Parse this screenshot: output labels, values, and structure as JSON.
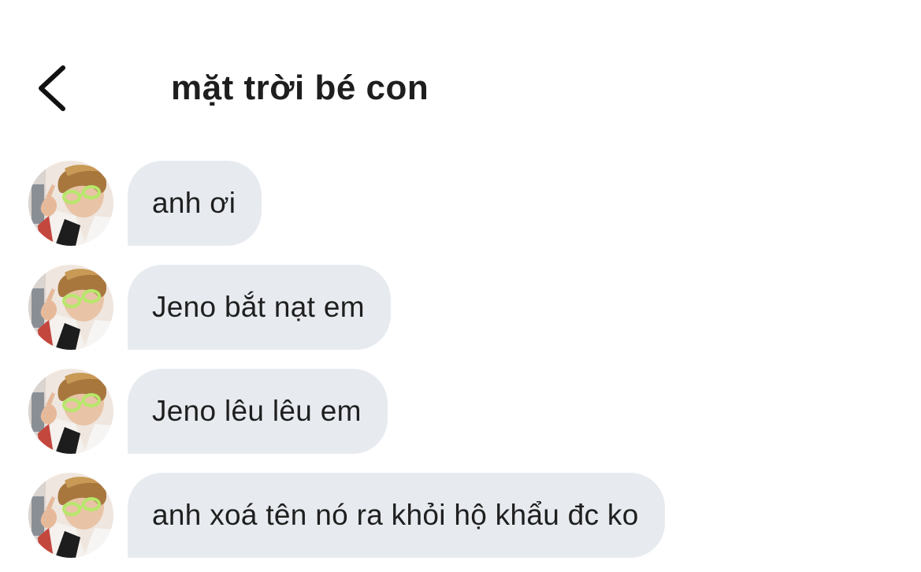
{
  "header": {
    "title": "mặt trời bé con",
    "back_icon": "chevron-left-icon"
  },
  "messages": [
    {
      "text": "anh ơi"
    },
    {
      "text": "Jeno bắt nạt em"
    },
    {
      "text": "Jeno lêu lêu em"
    },
    {
      "text": "anh xoá tên nó ra khỏi hộ khẩu đc ko"
    }
  ],
  "colors": {
    "background": "#ffffff",
    "bubble": "#e7ebf0",
    "text": "#1f1f1f"
  }
}
